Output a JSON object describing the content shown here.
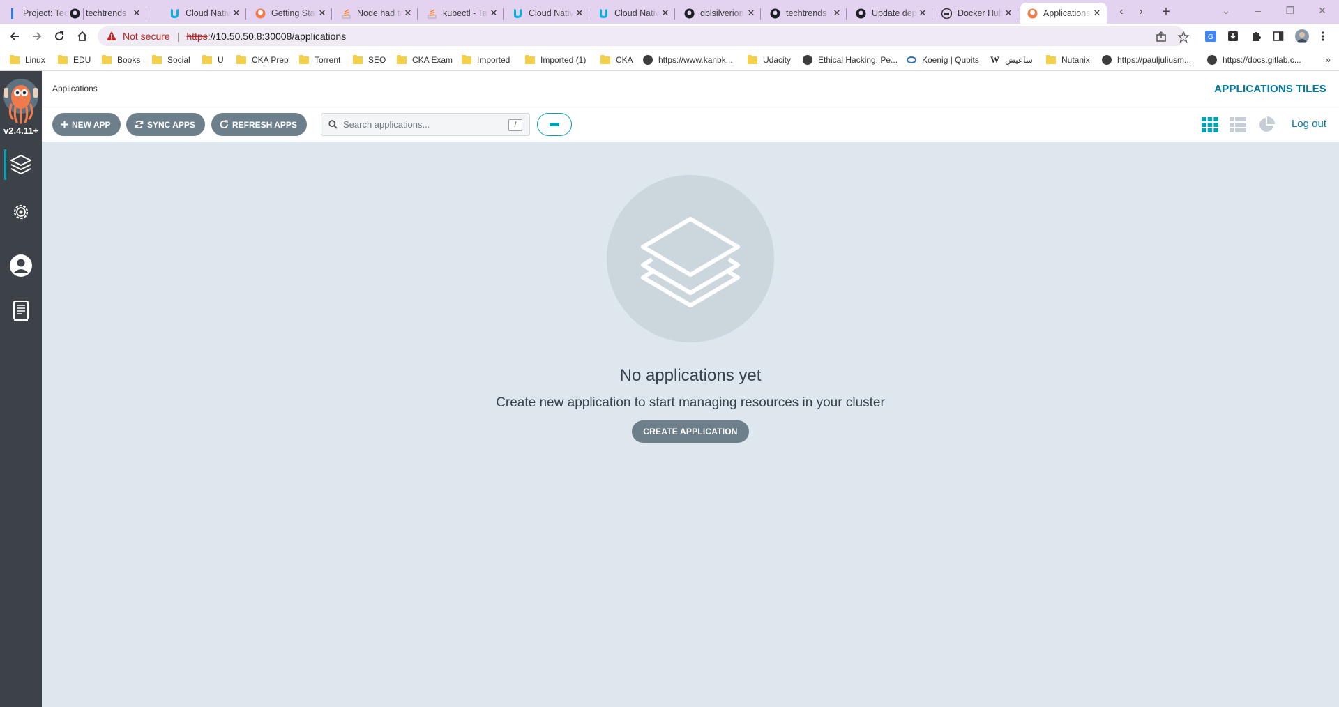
{
  "browser": {
    "tabs": [
      {
        "title": "Project: TechTrends",
        "icon": "blue-bar-icon"
      },
      {
        "title": "techtrends",
        "icon": "github-icon"
      },
      {
        "title": "Cloud Native",
        "icon": "udacity-icon"
      },
      {
        "title": "Getting Started",
        "icon": "argo-icon"
      },
      {
        "title": "Node had taints",
        "icon": "stackoverflow-icon"
      },
      {
        "title": "kubectl - Taint",
        "icon": "stackoverflow-icon"
      },
      {
        "title": "Cloud Native",
        "icon": "udacity-icon"
      },
      {
        "title": "Cloud Native",
        "icon": "udacity-icon"
      },
      {
        "title": "dblsilverion",
        "icon": "github-icon"
      },
      {
        "title": "techtrends",
        "icon": "github-icon"
      },
      {
        "title": "Update deployment",
        "icon": "github-icon"
      },
      {
        "title": "Docker Hub",
        "icon": "docker-icon"
      },
      {
        "title": "Applications",
        "icon": "argo-icon",
        "active": true
      }
    ],
    "address": {
      "security_label": "Not secure",
      "scheme": "https",
      "rest": "://10.50.50.8:30008/applications"
    },
    "bookmarks": [
      {
        "label": "Linux",
        "type": "folder"
      },
      {
        "label": "EDU",
        "type": "folder"
      },
      {
        "label": "Books",
        "type": "folder"
      },
      {
        "label": "Social",
        "type": "folder"
      },
      {
        "label": "U",
        "type": "folder"
      },
      {
        "label": "CKA Prep",
        "type": "folder"
      },
      {
        "label": "Torrent",
        "type": "folder"
      },
      {
        "label": "SEO",
        "type": "folder"
      },
      {
        "label": "CKA Exam",
        "type": "folder"
      },
      {
        "label": "Imported",
        "type": "folder"
      },
      {
        "label": "Imported (1)",
        "type": "folder"
      },
      {
        "label": "CKA",
        "type": "folder"
      },
      {
        "label": "https://www.kanbk...",
        "type": "globe"
      },
      {
        "label": "Udacity",
        "type": "folder"
      },
      {
        "label": "Ethical Hacking: Pe...",
        "type": "globe"
      },
      {
        "label": "Koenig | Qubits",
        "type": "koenig"
      },
      {
        "label": "ساعيش",
        "type": "wiki"
      },
      {
        "label": "Nutanix",
        "type": "folder"
      },
      {
        "label": "https://pauljuliusm...",
        "type": "globe"
      },
      {
        "label": "https://docs.gitlab.c...",
        "type": "globe"
      }
    ]
  },
  "app": {
    "version": "v2.4.11+",
    "breadcrumb": "Applications",
    "view_title": "APPLICATIONS TILES",
    "toolbar": {
      "new_app": "NEW APP",
      "sync_apps": "SYNC APPS",
      "refresh_apps": "REFRESH APPS",
      "search_placeholder": "Search applications...",
      "search_shortcut": "/",
      "logout": "Log out"
    },
    "empty_state": {
      "title": "No applications yet",
      "subtitle": "Create new application to start managing resources in your cluster",
      "button": "CREATE APPLICATION"
    },
    "colors": {
      "accent": "#00a2b3",
      "link": "#00789e",
      "button": "#6d7f8b",
      "sidebar": "#3d4248",
      "background": "#dee6ee"
    }
  }
}
